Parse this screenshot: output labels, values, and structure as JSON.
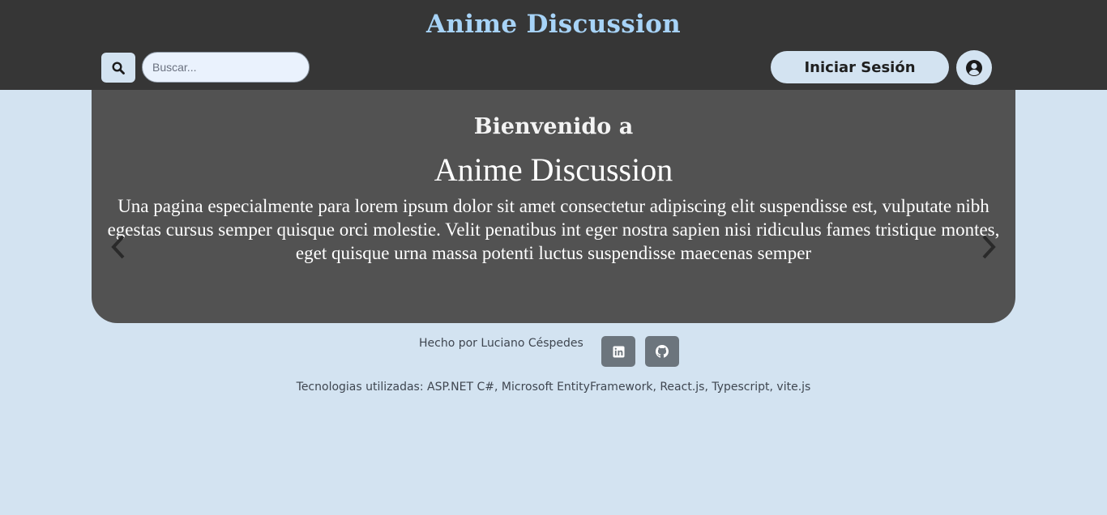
{
  "header": {
    "title": "Anime Discussion",
    "search_icon": "search-icon",
    "search_placeholder": "Buscar...",
    "search_value": "",
    "login_label": "Iniciar Sesión",
    "user_icon": "user-circle-icon"
  },
  "hero": {
    "welcome": "Bienvenido a",
    "title": "Anime Discussion",
    "text": "Una pagina especialmente para lorem ipsum dolor sit amet consectetur adipiscing elit suspendisse est, vulputate nibh egestas cursus semper quisque orci molestie. Velit penatibus int eger nostra sapien nisi ridiculus fames tristique montes, eget quisque urna massa potenti luctus suspendisse maecenas semper",
    "prev_icon": "chevron-left-icon",
    "next_icon": "chevron-right-icon"
  },
  "footer": {
    "credit": "Hecho por Luciano Céspedes",
    "linkedin_icon": "linkedin-icon",
    "github_icon": "github-icon",
    "technologies": "Tecnologias utilizadas: ASP.NET C#, Microsoft EntityFramework, React.js, Typescript, vite.js"
  },
  "colors": {
    "page_background": "#d3e3f1",
    "header_background": "#363636",
    "title_accent": "#a7d3f7",
    "hero_background": "#525252",
    "social_button": "#6c757d"
  }
}
